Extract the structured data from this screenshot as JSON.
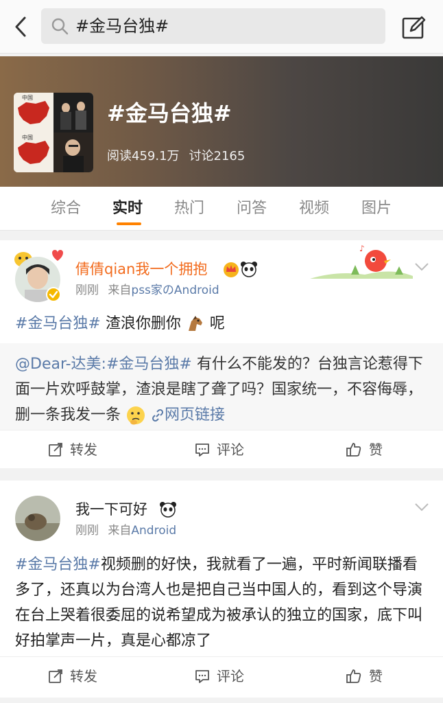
{
  "search": {
    "query": "#金马台独#"
  },
  "topic": {
    "title": "#金马台独#",
    "reads": "阅读459.1万",
    "discussions": "讨论2165"
  },
  "tabs": [
    {
      "label": "综合"
    },
    {
      "label": "实时"
    },
    {
      "label": "热门"
    },
    {
      "label": "问答"
    },
    {
      "label": "视频"
    },
    {
      "label": "图片"
    }
  ],
  "active_tab": "实时",
  "posts": [
    {
      "user": "倩倩qian我一个拥抱",
      "time": "刚刚",
      "source_prefix": "来自",
      "source": "pss家のAndroid",
      "tag": "#金马台独#",
      "text": " 渣浪你删你",
      "text_suffix": " 呢",
      "repost": {
        "author": "@Dear-达美:",
        "tag": "#金马台独#",
        "text": " 有什么不能发的？台独言论惹得下面一片欢呼鼓掌，渣浪是瞎了聋了吗？国家统一，不容侮辱，删一条我发一条",
        "link_label": "网页链接"
      },
      "actions": {
        "repost": "转发",
        "comment": "评论",
        "like": "赞"
      }
    },
    {
      "user": "我一下可好",
      "time": "刚刚",
      "source_prefix": "来自",
      "source": "Android",
      "tag": "#金马台独#",
      "text": "视频删的好快，我就看了一遍，平时新闻联播看多了，还真以为台湾人也是把自己当中国人的，看到这个导演在台上哭着很委屈的说希望成为被承认的独立的国家，底下叫好拍掌声一片，真是心都凉了",
      "actions": {
        "repost": "转发",
        "comment": "评论",
        "like": "赞"
      }
    }
  ],
  "colors": {
    "accent": "#ff8200",
    "link": "#5a7aa8",
    "username_highlight": "#f26b1d"
  }
}
